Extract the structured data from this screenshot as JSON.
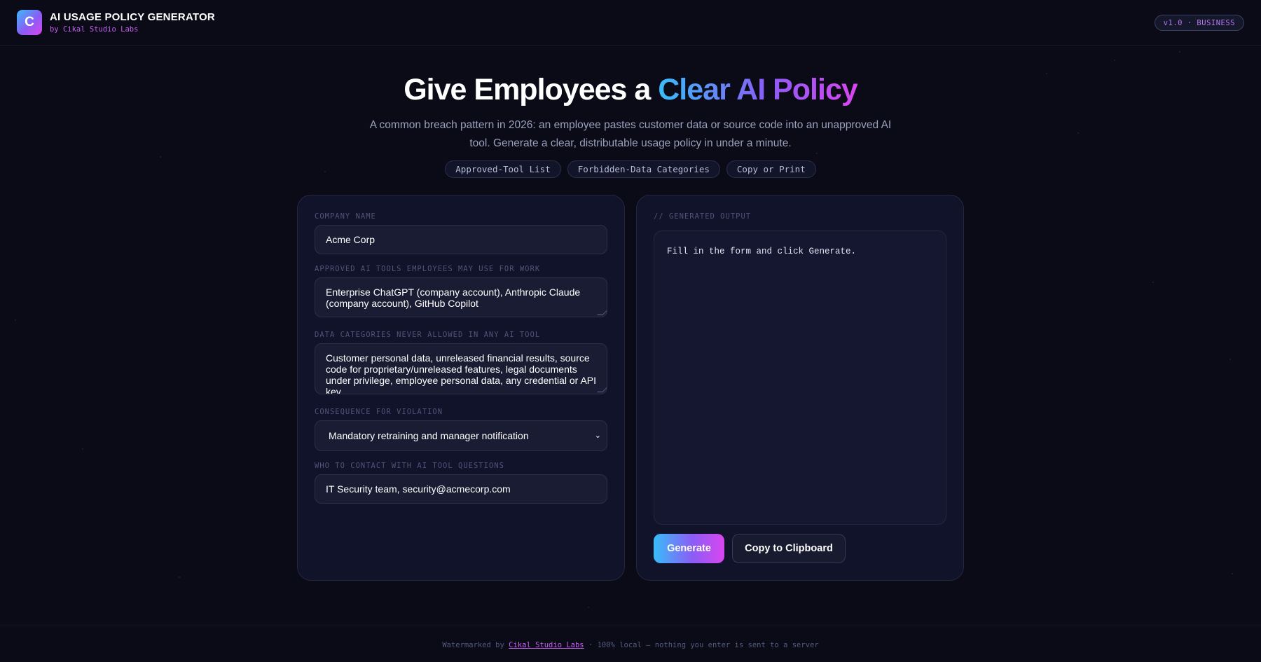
{
  "header": {
    "logo_letter": "C",
    "title": "AI USAGE POLICY GENERATOR",
    "subtitle": "by Cikal Studio Labs",
    "version": "v1.0 · BUSINESS"
  },
  "hero": {
    "title_plain": "Give Employees a ",
    "title_gradient": "Clear AI Policy",
    "description": "A common breach pattern in 2026: an employee pastes customer data or source code into an unapproved AI tool. Generate a clear, distributable usage policy in under a minute.",
    "tags": [
      "Approved-Tool List",
      "Forbidden-Data Categories",
      "Copy or Print"
    ]
  },
  "form": {
    "company_label": "COMPANY NAME",
    "company_value": "Acme Corp",
    "tools_label": "APPROVED AI TOOLS EMPLOYEES MAY USE FOR WORK",
    "tools_value": "Enterprise ChatGPT (company account), Anthropic Claude (company account), GitHub Copilot",
    "data_label": "DATA CATEGORIES NEVER ALLOWED IN ANY AI TOOL",
    "data_value": "Customer personal data, unreleased financial results, source code for proprietary/unreleased features, legal documents under privilege, employee personal data, any credential or API key",
    "consequence_label": "CONSEQUENCE FOR VIOLATION",
    "consequence_value": "Mandatory retraining and manager notification",
    "contact_label": "WHO TO CONTACT WITH AI TOOL QUESTIONS",
    "contact_value": "IT Security team, security@acmecorp.com"
  },
  "output": {
    "label": "// GENERATED OUTPUT",
    "placeholder_text": "Fill in the form and click Generate.",
    "generate_label": "Generate",
    "copy_label": "Copy to Clipboard"
  },
  "footer": {
    "prefix": "Watermarked by ",
    "link_text": "Cikal Studio Labs",
    "suffix": " · 100% local — nothing you enter is sent to a server"
  },
  "colors": {
    "background": "#0a0b16",
    "panel": "#11132a",
    "accent_start": "#38bdf8",
    "accent_mid": "#8b5cf6",
    "accent_end": "#d946ef"
  }
}
